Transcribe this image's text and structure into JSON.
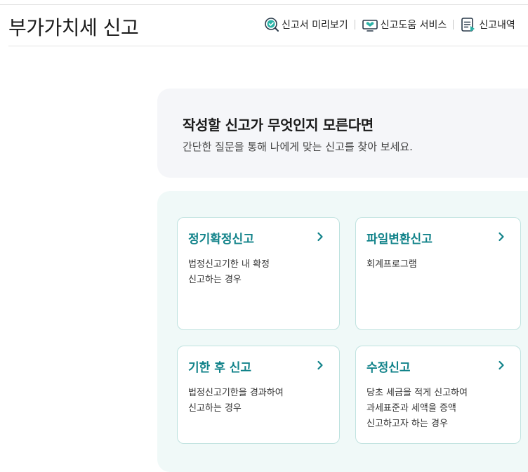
{
  "header": {
    "title": "부가가치세 신고",
    "links": [
      {
        "label": "신고서 미리보기",
        "icon": "magnifier-check-icon"
      },
      {
        "label": "신고도움 서비스",
        "icon": "monitor-heart-icon"
      },
      {
        "label": "신고내역",
        "icon": "document-list-icon"
      }
    ]
  },
  "guide": {
    "heading": "작성할 신고가 무엇인지 모른다면",
    "text": "간단한 질문을 통해 나에게 맞는 신고를 찾아 보세요."
  },
  "cards": [
    {
      "title": "정기확정신고",
      "lines": [
        "법정신고기한 내 확정",
        "신고하는 경우"
      ]
    },
    {
      "title": "파일변환신고",
      "lines": [
        "회계프로그램"
      ]
    },
    {
      "title": "기한 후 신고",
      "lines": [
        "법정신고기한을 경과하여",
        "신고하는 경우"
      ]
    },
    {
      "title": "수정신고",
      "lines": [
        "당초 세금을 적게 신고하여",
        "과세표준과 세액을 증액",
        "신고하고자 하는 경우"
      ]
    }
  ],
  "colors": {
    "accent": "#12838a",
    "card_border": "#bfe2df",
    "panel_bg": "#f0f9f8",
    "guide_bg": "#f5f6f9"
  }
}
